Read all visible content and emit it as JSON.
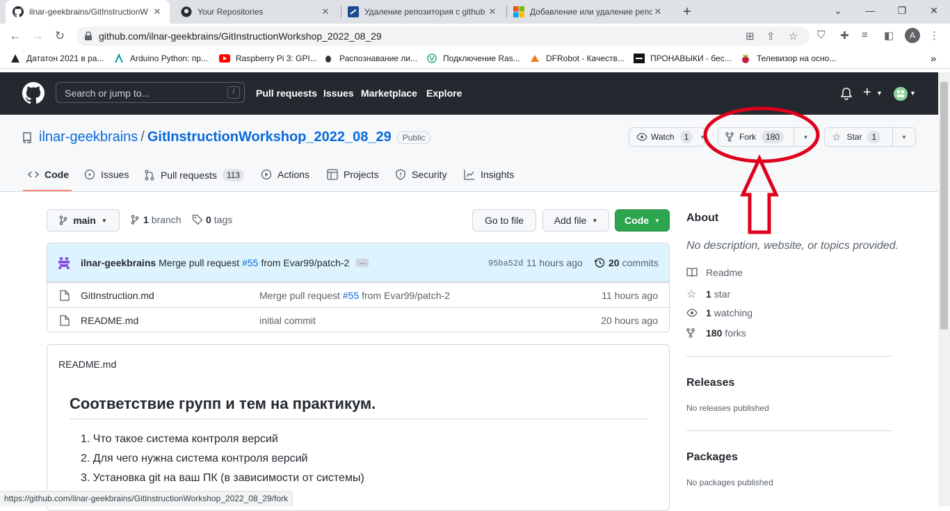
{
  "browser": {
    "tabs": [
      {
        "title": "ilnar-geekbrains/GitInstructionW",
        "close": "✕",
        "active": true
      },
      {
        "title": "Your Repositories",
        "close": "✕",
        "active": false
      },
      {
        "title": "Удаление репозитория с github",
        "close": "✕",
        "active": false
      },
      {
        "title": "Добавление или удаление репо",
        "close": "✕",
        "active": false
      }
    ],
    "new_tab": "+",
    "url": "github.com/ilnar-geekbrains/GitInstructionWorkshop_2022_08_29",
    "avatar_letter": "A",
    "bookmarks": [
      {
        "label": "Дататон 2021 в ра...",
        "icon": "triangle-icon"
      },
      {
        "label": "Arduino Python: пр...",
        "icon": "arduino-icon"
      },
      {
        "label": "Raspberry Pi 3: GPI...",
        "icon": "youtube-icon"
      },
      {
        "label": "Распознавание ли...",
        "icon": "bug-icon"
      },
      {
        "label": "Подключение Ras...",
        "icon": "vue-icon"
      },
      {
        "label": "DFRobot - Качеств...",
        "icon": "dfrobot-icon"
      },
      {
        "label": "ПРОНАВЫКИ - бес...",
        "icon": "pronavyki-icon"
      },
      {
        "label": "Телевизор на осно...",
        "icon": "raspberry-icon"
      }
    ],
    "bookmarks_more": "»",
    "status_url": "https://github.com/ilnar-geekbrains/GitInstructionWorkshop_2022_08_29/fork"
  },
  "gh_header": {
    "search_placeholder": "Search or jump to...",
    "slash": "/",
    "nav": [
      "Pull requests",
      "Issues",
      "Marketplace",
      "Explore"
    ],
    "plus": "+"
  },
  "repo": {
    "owner": "ilnar-geekbrains",
    "sep": "/",
    "name": "GitInstructionWorkshop_2022_08_29",
    "visibility": "Public",
    "watch_label": "Watch",
    "watch_count": "1",
    "fork_label": "Fork",
    "fork_count": "180",
    "star_label": "Star",
    "star_count": "1",
    "tabs": [
      {
        "label": "Code",
        "count": ""
      },
      {
        "label": "Issues",
        "count": ""
      },
      {
        "label": "Pull requests",
        "count": "113"
      },
      {
        "label": "Actions",
        "count": ""
      },
      {
        "label": "Projects",
        "count": ""
      },
      {
        "label": "Security",
        "count": ""
      },
      {
        "label": "Insights",
        "count": ""
      }
    ]
  },
  "toolbar": {
    "branch": "main",
    "branches_count": "1",
    "branches_label": "branch",
    "tags_count": "0",
    "tags_label": "tags",
    "go_to_file": "Go to file",
    "add_file": "Add file",
    "code": "Code"
  },
  "latest_commit": {
    "author": "ilnar-geekbrains",
    "message_pre": "Merge pull request",
    "pr": "#55",
    "message_post": "from Evar99/patch-2",
    "ellipsis": "…",
    "sha": "95ba52d",
    "time": "11 hours ago",
    "commits_count": "20",
    "commits_label": "commits"
  },
  "files": [
    {
      "name": "GitInstruction.md",
      "msg_pre": "Merge pull request",
      "msg_link": "#55",
      "msg_post": "from Evar99/patch-2",
      "time": "11 hours ago"
    },
    {
      "name": "README.md",
      "msg_pre": "initial commit",
      "msg_link": "",
      "msg_post": "",
      "time": "20 hours ago"
    }
  ],
  "readme": {
    "filename": "README.md",
    "heading": "Соответствие групп и тем на практикум.",
    "items": [
      "1. Что такое система контроля версий",
      "2. Для чего нужна система контроля версий",
      "3. Установка git на ваш ПК (в зависимости от системы)"
    ]
  },
  "about": {
    "title": "About",
    "description": "No description, website, or topics provided.",
    "readme": "Readme",
    "stars_count": "1",
    "stars_label": "star",
    "watching_count": "1",
    "watching_label": "watching",
    "forks_count": "180",
    "forks_label": "forks",
    "releases_title": "Releases",
    "releases_text": "No releases published",
    "packages_title": "Packages",
    "packages_text": "No packages published"
  },
  "annotation_color": "#e0001b",
  "colors": {
    "header_bg": "#24292f",
    "link": "#0969da",
    "green": "#2da44e",
    "tab_underline": "#fd8c73"
  }
}
